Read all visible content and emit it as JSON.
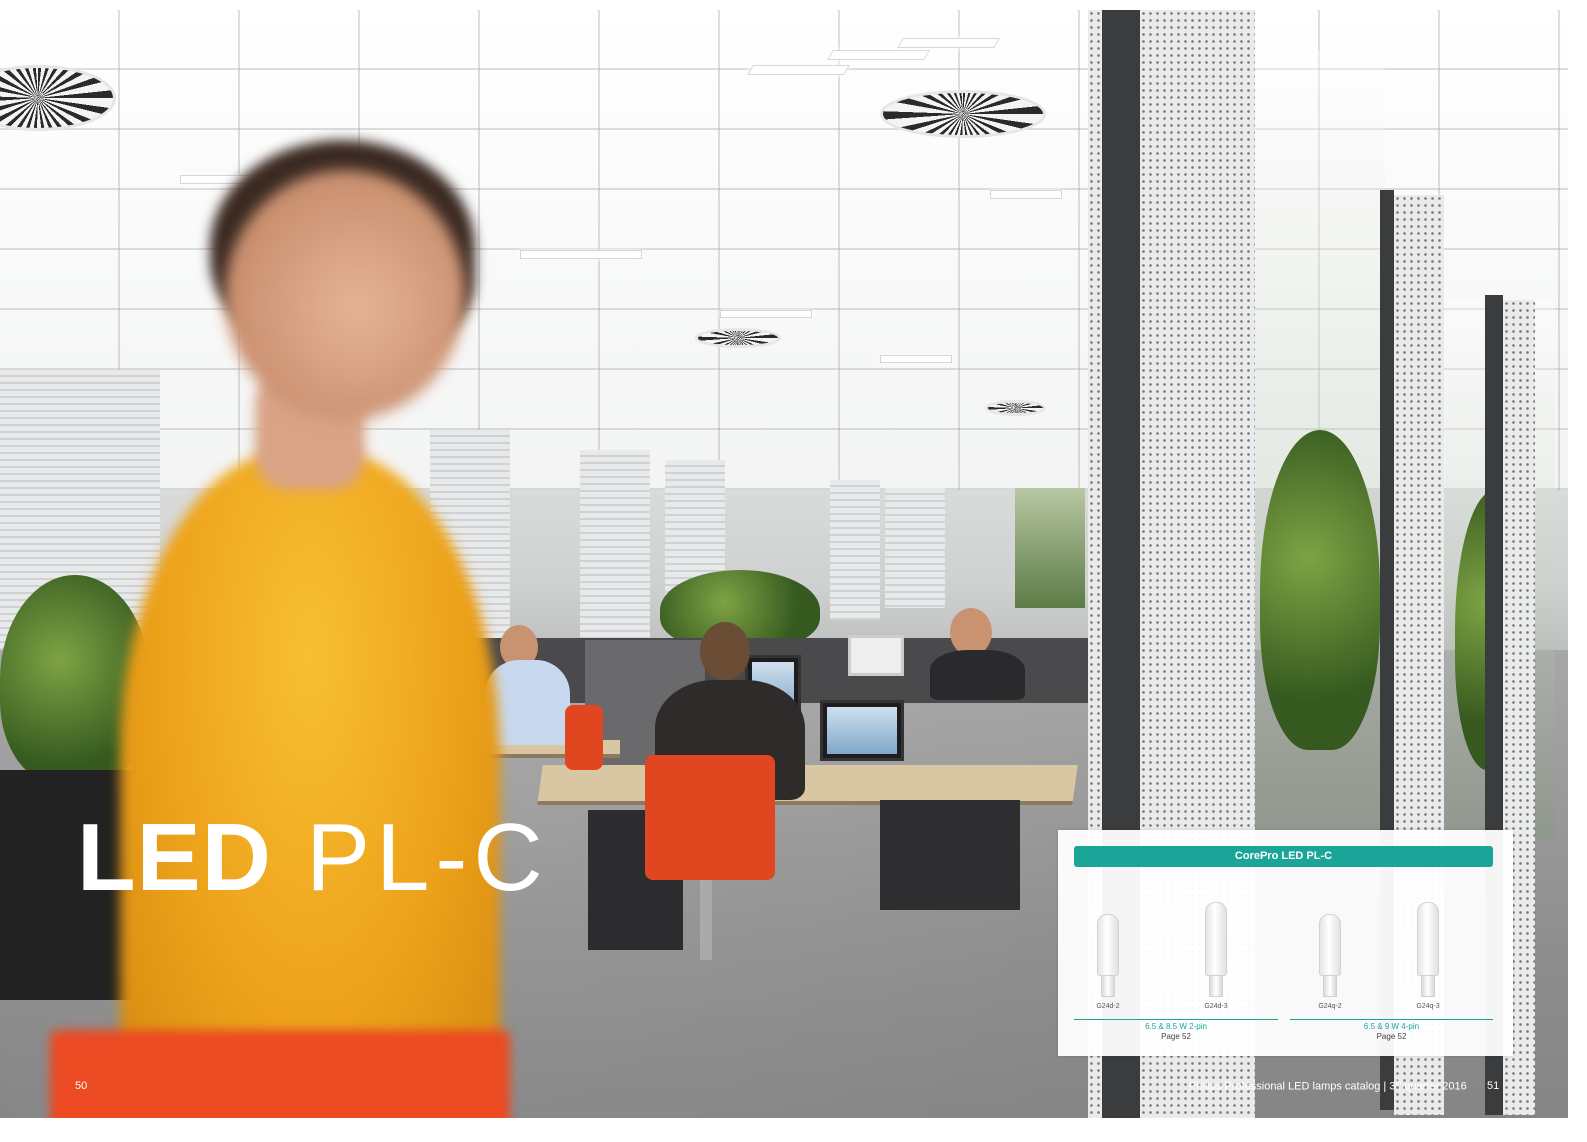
{
  "title": {
    "bold": "LED",
    "light": "PL-C"
  },
  "footer": {
    "left_page": "50",
    "catalog_text": "Philips Professional LED lamps catalog | 3",
    "superscript": "th",
    "catalog_suffix": " quarter 2016",
    "right_page": "51"
  },
  "product_panel": {
    "header": "CorePro LED PL-C",
    "lamps": [
      {
        "label": "G24d-2"
      },
      {
        "label": "G24d-3"
      },
      {
        "label": "G24q-2"
      },
      {
        "label": "G24q-3"
      }
    ],
    "groups": [
      {
        "spec": "6.5 & 8.5 W 2-pin",
        "page": "Page 52"
      },
      {
        "spec": "6.5 & 9 W 4-pin",
        "page": "Page 52"
      }
    ]
  },
  "colors": {
    "accent_teal": "#1aa598",
    "sweater_yellow": "#eda21a",
    "folder_orange": "#ec4a22"
  }
}
